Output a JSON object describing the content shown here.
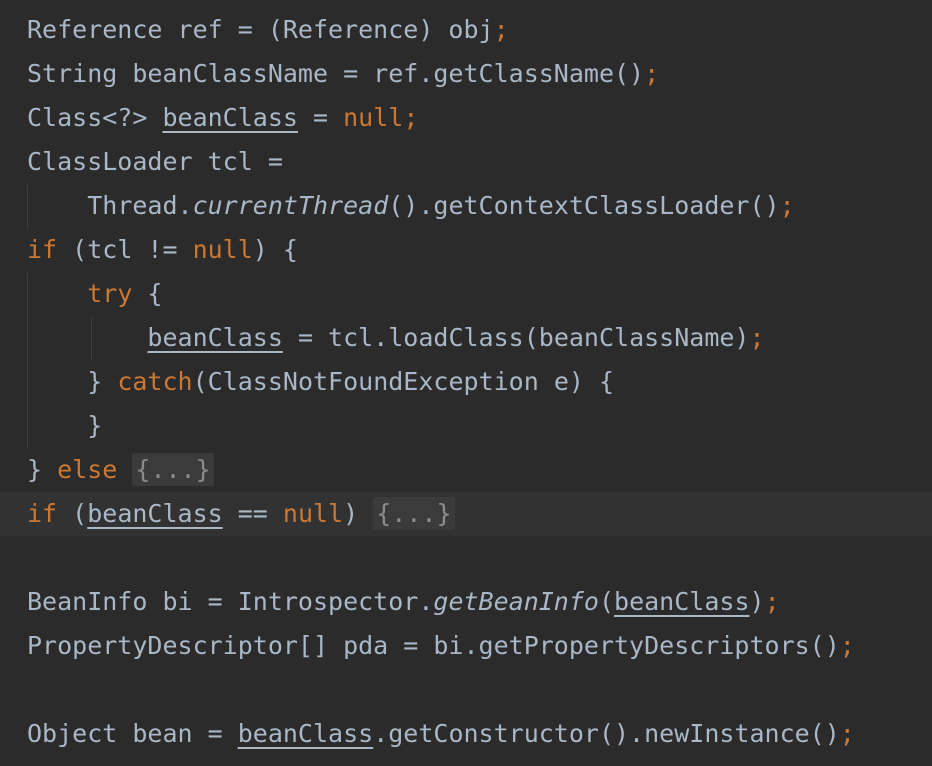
{
  "code": {
    "l1": {
      "t1": "Reference ref = (Reference) obj",
      "semi": ";"
    },
    "l2": {
      "t1": "String beanClassName = ref.getClassName()",
      "semi": ";"
    },
    "l3": {
      "t1": "Class<?> ",
      "var": "beanClass",
      "t2": " = ",
      "kw": "null",
      "semi": ";"
    },
    "l4": {
      "t1": "ClassLoader tcl ="
    },
    "l5": {
      "indent": "    ",
      "t1": "Thread.",
      "it": "currentThread",
      "t2": "().getContextClassLoader()",
      "semi": ";"
    },
    "l6": {
      "kw1": "if",
      "t1": " (tcl != ",
      "kw2": "null",
      "t2": ") {"
    },
    "l7": {
      "indent": "    ",
      "kw": "try",
      "t1": " {"
    },
    "l8": {
      "indent": "        ",
      "var": "beanClass",
      "t1": " = tcl.loadClass(beanClassName)",
      "semi": ";"
    },
    "l9": {
      "indent": "    ",
      "t1": "} ",
      "kw": "catch",
      "t2": "(ClassNotFoundException e) {"
    },
    "l10": {
      "indent": "    ",
      "t1": "}"
    },
    "l11": {
      "t1": "} ",
      "kw": "else",
      "sp": " ",
      "fold": "{...}"
    },
    "l12": {
      "kw1": "if",
      "t1": " (",
      "var": "beanClass",
      "t2": " == ",
      "kw2": "null",
      "t3": ") ",
      "fold": "{...}"
    },
    "l14": {
      "t1": "BeanInfo bi = Introspector.",
      "it": "getBeanInfo",
      "t2": "(",
      "var": "beanClass",
      "t3": ")",
      "semi": ";"
    },
    "l15": {
      "t1": "PropertyDescriptor[] pda = bi.getPropertyDescriptors()",
      "semi": ";"
    },
    "l17": {
      "t1": "Object bean = ",
      "var": "beanClass",
      "t2": ".getConstructor().newInstance()",
      "semi": ";"
    }
  }
}
